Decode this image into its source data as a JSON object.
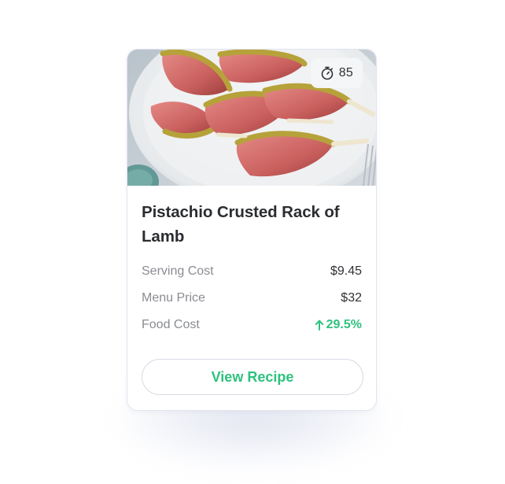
{
  "card": {
    "title": "Pistachio Crusted Rack of Lamb",
    "timer": {
      "icon": "stopwatch-icon",
      "value": "85"
    },
    "rows": [
      {
        "label": "Serving Cost",
        "value": "$9.45"
      },
      {
        "label": "Menu Price",
        "value": "$32"
      },
      {
        "label": "Food Cost",
        "value": "29.5%",
        "trend_icon": "arrow-up-icon",
        "trend": "up"
      }
    ],
    "cta_label": "View Recipe"
  },
  "colors": {
    "accent_green": "#2ec27e",
    "text_dark": "#2b2d31",
    "text_muted": "#8a8c92",
    "border": "#d9dbe5"
  }
}
